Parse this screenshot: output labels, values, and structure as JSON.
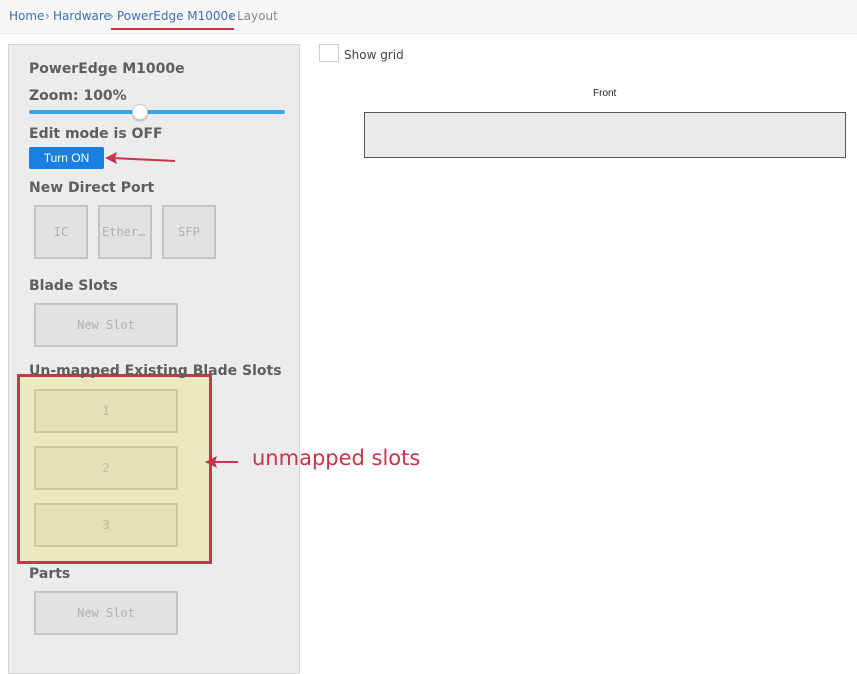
{
  "breadcrumb": {
    "items": [
      "Home",
      "Hardware",
      "PowerEdge M1000e",
      "Layout"
    ],
    "separator": "›"
  },
  "sidebar": {
    "title": "PowerEdge M1000e",
    "zoom_label": "Zoom: 100%",
    "zoom_value_percent": 100,
    "edit_mode_label": "Edit mode is OFF",
    "turn_on_button": "Turn ON",
    "direct_port_heading": "New Direct Port",
    "direct_ports": [
      "IC",
      "Ethernet",
      "SFP"
    ],
    "blade_slots_heading": "Blade Slots",
    "new_slot_label": "New Slot",
    "unmapped_heading": "Un-mapped Existing Blade Slots",
    "unmapped_slots": [
      "1",
      "2",
      "3"
    ],
    "parts_heading": "Parts",
    "parts_new_slot_label": "New Slot"
  },
  "canvas": {
    "show_grid_label": "Show grid",
    "show_grid_checked": false,
    "front_label": "Front"
  },
  "annotation": {
    "text": "unmapped slots",
    "color": "#c8344a"
  },
  "colors": {
    "accent": "#1b7fe0",
    "slider": "#3aa5ef",
    "annotation": "#c8344a",
    "link": "#3f6fb5"
  }
}
